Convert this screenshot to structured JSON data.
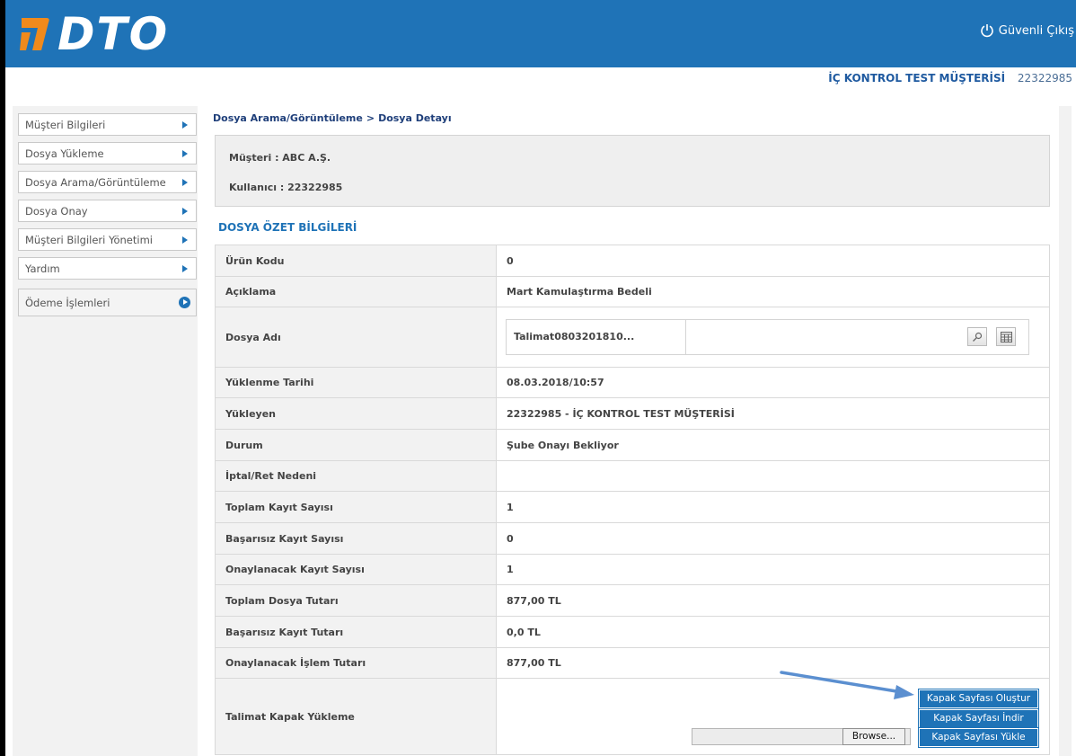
{
  "header": {
    "logo_text": "DTO",
    "logout_label": "Güvenli Çıkış"
  },
  "user": {
    "name": "İÇ KONTROL TEST MÜŞTERİSİ",
    "id": "22322985"
  },
  "sidebar": {
    "items": [
      {
        "label": "Müşteri Bilgileri"
      },
      {
        "label": "Dosya Yükleme"
      },
      {
        "label": "Dosya Arama/Görüntüleme"
      },
      {
        "label": "Dosya Onay"
      },
      {
        "label": "Müşteri Bilgileri Yönetimi"
      },
      {
        "label": "Yardım"
      },
      {
        "label": "Ödeme İşlemleri"
      }
    ]
  },
  "breadcrumb": {
    "parent": "Dosya Arama/Görüntüleme",
    "separator": ">",
    "current": "Dosya Detayı"
  },
  "info": {
    "customer": "Müşteri :  ABC A.Ş.",
    "user": "Kullanıcı : 22322985"
  },
  "section_title": "DOSYA ÖZET BİLGİLERİ",
  "details": {
    "urun_kodu": {
      "label": "Ürün Kodu",
      "value": "0"
    },
    "aciklama": {
      "label": "Açıklama",
      "value": "Mart Kamulaştırma Bedeli"
    },
    "dosya_adi": {
      "label": "Dosya Adı",
      "value": "Talimat0803201810..."
    },
    "yuklenme_tarihi": {
      "label": "Yüklenme Tarihi",
      "value": "08.03.2018/10:57"
    },
    "yukleyen": {
      "label": "Yükleyen",
      "value": "22322985 - İÇ KONTROL TEST MÜŞTERİSİ"
    },
    "durum": {
      "label": "Durum",
      "value": "Şube Onayı Bekliyor"
    },
    "iptal_ret": {
      "label": "İptal/Ret Nedeni",
      "value": ""
    },
    "toplam_kayit": {
      "label": "Toplam Kayıt Sayısı",
      "value": "1"
    },
    "basarisiz_kayit": {
      "label": "Başarısız Kayıt Sayısı",
      "value": "0"
    },
    "onaylanacak_kayit": {
      "label": "Onaylanacak Kayıt Sayısı",
      "value": "1"
    },
    "toplam_tutar": {
      "label": "Toplam Dosya Tutarı",
      "value": "877,00 TL"
    },
    "basarisiz_tutar": {
      "label": "Başarısız Kayıt Tutarı",
      "value": "0,0 TL"
    },
    "onaylanacak_tutar": {
      "label": "Onaylanacak İşlem Tutarı",
      "value": "877,00 TL"
    },
    "kapak": {
      "label": "Talimat Kapak Yükleme"
    }
  },
  "buttons": {
    "olustur": "Kapak Sayfası Oluştur",
    "indir": "Kapak Sayfası İndir",
    "yukle": "Kapak Sayfası Yükle",
    "browse": "Browse..."
  },
  "icons": {
    "search": "magnifier-icon",
    "calendar": "calendar-icon"
  },
  "colors": {
    "brand_blue": "#1f73b7",
    "logo_orange": "#f08a1c"
  }
}
